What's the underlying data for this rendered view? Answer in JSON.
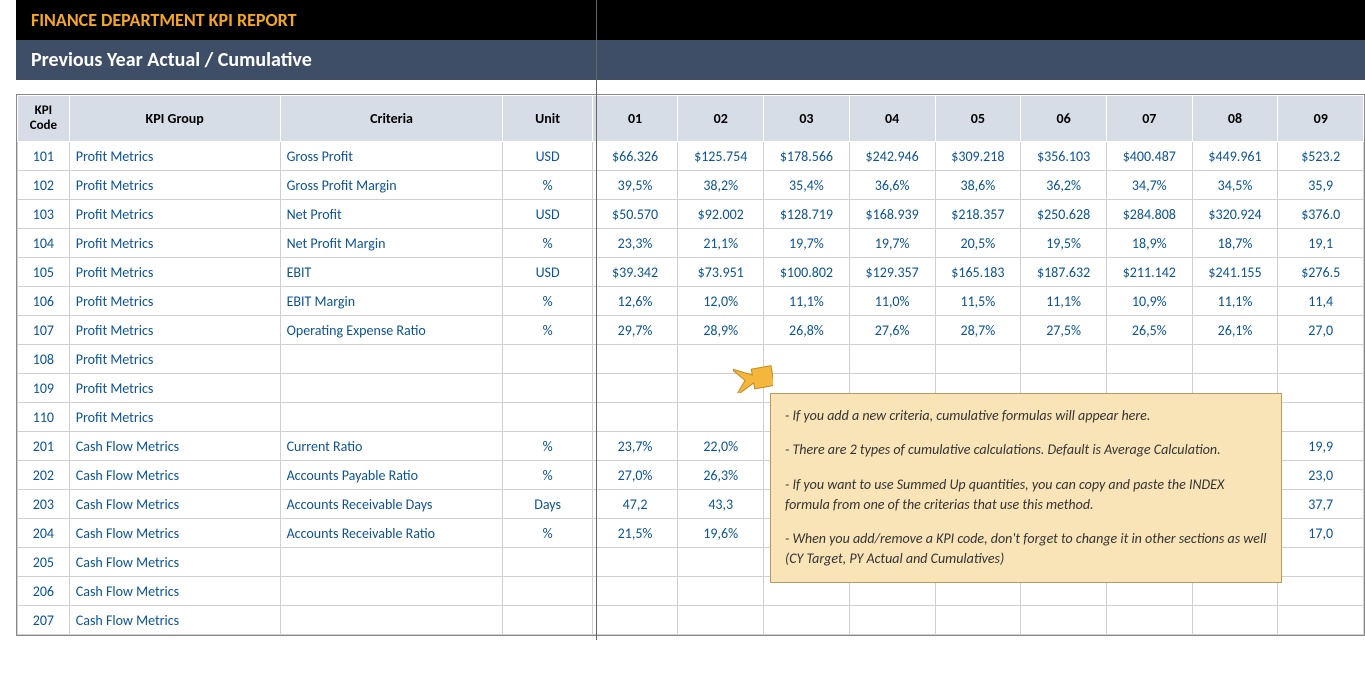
{
  "header": {
    "title": "FINANCE DEPARTMENT KPI REPORT",
    "subtitle": "Previous Year Actual / Cumulative"
  },
  "columns": {
    "kpi_code": "KPI Code",
    "kpi_group": "KPI Group",
    "criteria": "Criteria",
    "unit": "Unit",
    "months": [
      "01",
      "02",
      "03",
      "04",
      "05",
      "06",
      "07",
      "08",
      "09"
    ]
  },
  "rows": [
    {
      "code": "101",
      "group": "Profit Metrics",
      "criteria": "Gross Profit",
      "unit": "USD",
      "vals": [
        "$66.326",
        "$125.754",
        "$178.566",
        "$242.946",
        "$309.218",
        "$356.103",
        "$400.487",
        "$449.961",
        "$523.2"
      ]
    },
    {
      "code": "102",
      "group": "Profit Metrics",
      "criteria": "Gross Profit Margin",
      "unit": "%",
      "vals": [
        "39,5%",
        "38,2%",
        "35,4%",
        "36,6%",
        "38,6%",
        "36,2%",
        "34,7%",
        "34,5%",
        "35,9"
      ]
    },
    {
      "code": "103",
      "group": "Profit Metrics",
      "criteria": "Net Profit",
      "unit": "USD",
      "vals": [
        "$50.570",
        "$92.002",
        "$128.719",
        "$168.939",
        "$218.357",
        "$250.628",
        "$284.808",
        "$320.924",
        "$376.0"
      ]
    },
    {
      "code": "104",
      "group": "Profit Metrics",
      "criteria": "Net Profit Margin",
      "unit": "%",
      "vals": [
        "23,3%",
        "21,1%",
        "19,7%",
        "19,7%",
        "20,5%",
        "19,5%",
        "18,9%",
        "18,7%",
        "19,1"
      ]
    },
    {
      "code": "105",
      "group": "Profit Metrics",
      "criteria": "EBIT",
      "unit": "USD",
      "vals": [
        "$39.342",
        "$73.951",
        "$100.802",
        "$129.357",
        "$165.183",
        "$187.632",
        "$211.142",
        "$241.155",
        "$276.5"
      ]
    },
    {
      "code": "106",
      "group": "Profit Metrics",
      "criteria": "EBIT Margin",
      "unit": "%",
      "vals": [
        "12,6%",
        "12,0%",
        "11,1%",
        "11,0%",
        "11,5%",
        "11,1%",
        "10,9%",
        "11,1%",
        "11,4"
      ]
    },
    {
      "code": "107",
      "group": "Profit Metrics",
      "criteria": "Operating Expense Ratio",
      "unit": "%",
      "vals": [
        "29,7%",
        "28,9%",
        "26,8%",
        "27,6%",
        "28,7%",
        "27,5%",
        "26,5%",
        "26,1%",
        "27,0"
      ]
    },
    {
      "code": "108",
      "group": "Profit Metrics",
      "criteria": "",
      "unit": "",
      "vals": [
        "",
        "",
        "",
        "",
        "",
        "",
        "",
        "",
        ""
      ]
    },
    {
      "code": "109",
      "group": "Profit Metrics",
      "criteria": "",
      "unit": "",
      "vals": [
        "",
        "",
        "",
        "",
        "",
        "",
        "",
        "",
        ""
      ]
    },
    {
      "code": "110",
      "group": "Profit Metrics",
      "criteria": "",
      "unit": "",
      "vals": [
        "",
        "",
        "",
        "",
        "",
        "",
        "",
        "",
        ""
      ]
    },
    {
      "code": "201",
      "group": "Cash Flow Metrics",
      "criteria": "Current Ratio",
      "unit": "%",
      "vals": [
        "23,7%",
        "22,0%",
        "",
        "",
        "",
        "",
        "",
        "",
        "19,9"
      ]
    },
    {
      "code": "202",
      "group": "Cash Flow Metrics",
      "criteria": "Accounts Payable Ratio",
      "unit": "%",
      "vals": [
        "27,0%",
        "26,3%",
        "",
        "",
        "",
        "",
        "",
        "",
        "23,0"
      ]
    },
    {
      "code": "203",
      "group": "Cash Flow Metrics",
      "criteria": "Accounts Receivable Days",
      "unit": "Days",
      "vals": [
        "47,2",
        "43,3",
        "",
        "",
        "",
        "",
        "",
        "",
        "37,7"
      ]
    },
    {
      "code": "204",
      "group": "Cash Flow Metrics",
      "criteria": "Accounts Receivable Ratio",
      "unit": "%",
      "vals": [
        "21,5%",
        "19,6%",
        "",
        "",
        "",
        "",
        "",
        "",
        "17,0"
      ]
    },
    {
      "code": "205",
      "group": "Cash Flow Metrics",
      "criteria": "",
      "unit": "",
      "vals": [
        "",
        "",
        "",
        "",
        "",
        "",
        "",
        "",
        ""
      ]
    },
    {
      "code": "206",
      "group": "Cash Flow Metrics",
      "criteria": "",
      "unit": "",
      "vals": [
        "",
        "",
        "",
        "",
        "",
        "",
        "",
        "",
        ""
      ]
    },
    {
      "code": "207",
      "group": "Cash Flow Metrics",
      "criteria": "",
      "unit": "",
      "vals": [
        "",
        "",
        "",
        "",
        "",
        "",
        "",
        "",
        ""
      ]
    }
  ],
  "note": {
    "lines": [
      "- If you add a new criteria, cumulative formulas will appear here.",
      "- There are 2 types of cumulative calculations. Default is Average Calculation.",
      "- If you want to use Summed Up quantities, you can copy and paste the INDEX formula from one of the criterias that use this method.",
      "- When you add/remove a KPI code, don't forget to change it in other sections as well (CY Target, PY Actual and Cumulatives)"
    ]
  }
}
